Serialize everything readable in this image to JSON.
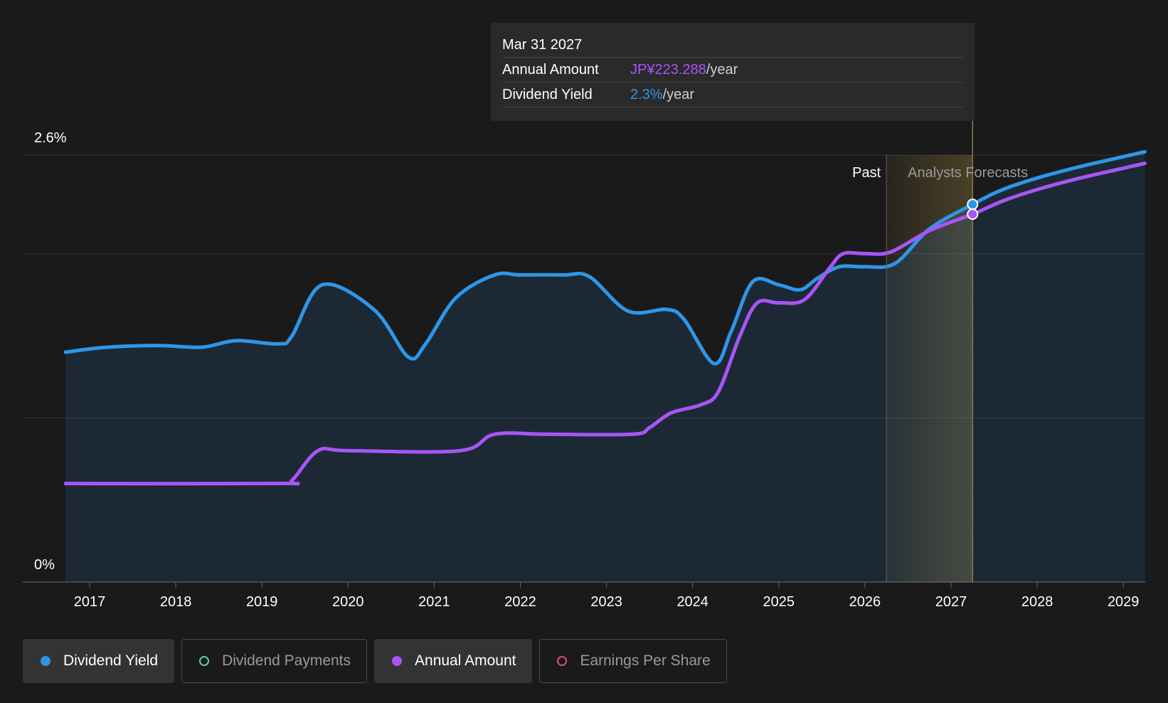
{
  "chart_data": {
    "type": "line",
    "ylim_label_top": "2.6%",
    "ylim_label_bottom": "0%",
    "x_ticks": [
      "2017",
      "2018",
      "2019",
      "2020",
      "2021",
      "2022",
      "2023",
      "2024",
      "2025",
      "2026",
      "2027",
      "2028",
      "2029"
    ],
    "period_labels": {
      "past": "Past",
      "forecast": "Analysts Forecasts"
    },
    "series": [
      {
        "name": "Dividend Yield",
        "color": "#2e96e8",
        "unit": "%",
        "points": [
          [
            2016.72,
            1.4
          ],
          [
            2017.2,
            1.43
          ],
          [
            2017.8,
            1.44
          ],
          [
            2018.3,
            1.43
          ],
          [
            2018.7,
            1.47
          ],
          [
            2019.2,
            1.45
          ],
          [
            2019.35,
            1.5
          ],
          [
            2019.7,
            1.81
          ],
          [
            2020.3,
            1.66
          ],
          [
            2020.7,
            1.37
          ],
          [
            2020.9,
            1.45
          ],
          [
            2021.25,
            1.73
          ],
          [
            2021.7,
            1.87
          ],
          [
            2022.0,
            1.87
          ],
          [
            2022.5,
            1.87
          ],
          [
            2022.8,
            1.86
          ],
          [
            2023.25,
            1.65
          ],
          [
            2023.7,
            1.66
          ],
          [
            2023.9,
            1.6
          ],
          [
            2024.25,
            1.33
          ],
          [
            2024.45,
            1.53
          ],
          [
            2024.7,
            1.83
          ],
          [
            2025.0,
            1.81
          ],
          [
            2025.25,
            1.78
          ],
          [
            2025.45,
            1.85
          ],
          [
            2025.7,
            1.92
          ],
          [
            2026.0,
            1.92
          ],
          [
            2026.35,
            1.94
          ],
          [
            2026.75,
            2.15
          ],
          [
            2027.25,
            2.3
          ],
          [
            2027.6,
            2.39
          ],
          [
            2028.0,
            2.46
          ],
          [
            2028.5,
            2.53
          ],
          [
            2029.0,
            2.59
          ],
          [
            2029.25,
            2.62
          ]
        ]
      },
      {
        "name": "Annual Amount",
        "color": "#a855f7",
        "unit": "JP¥",
        "points": [
          [
            2016.72,
            0.6
          ],
          [
            2019.2,
            0.6
          ],
          [
            2019.35,
            0.62
          ],
          [
            2019.65,
            0.8
          ],
          [
            2020.0,
            0.8
          ],
          [
            2021.3,
            0.8
          ],
          [
            2021.7,
            0.9
          ],
          [
            2022.3,
            0.9
          ],
          [
            2023.3,
            0.9
          ],
          [
            2023.5,
            0.94
          ],
          [
            2023.75,
            1.03
          ],
          [
            2024.1,
            1.08
          ],
          [
            2024.3,
            1.16
          ],
          [
            2024.55,
            1.5
          ],
          [
            2024.75,
            1.7
          ],
          [
            2025.0,
            1.7
          ],
          [
            2025.3,
            1.72
          ],
          [
            2025.6,
            1.92
          ],
          [
            2025.75,
            2.0
          ],
          [
            2026.0,
            2.0
          ],
          [
            2026.3,
            2.01
          ],
          [
            2026.75,
            2.14
          ],
          [
            2027.25,
            2.24
          ],
          [
            2027.6,
            2.32
          ],
          [
            2028.0,
            2.39
          ],
          [
            2028.5,
            2.46
          ],
          [
            2029.0,
            2.52
          ],
          [
            2029.25,
            2.55
          ]
        ]
      }
    ],
    "y_gridlines_percent": [
      0,
      1.0,
      2.0,
      2.6
    ],
    "past_end_year": 2026.25,
    "forecast_marker_year": 2027.25,
    "highlight": {
      "yield_at_marker": 2.3,
      "amount_at_marker": 2.24
    }
  },
  "tooltip": {
    "date": "Mar 31 2027",
    "amount_label": "Annual Amount",
    "amount_value": "JP¥223.288",
    "amount_unit": "/year",
    "yield_label": "Dividend Yield",
    "yield_value": "2.3%",
    "yield_unit": "/year"
  },
  "legend": [
    {
      "label": "Dividend Yield",
      "active": true,
      "color": "#2e96e8",
      "filled": true
    },
    {
      "label": "Dividend Payments",
      "active": false,
      "color": "#5ecfb8",
      "filled": false
    },
    {
      "label": "Annual Amount",
      "active": true,
      "color": "#a855f7",
      "filled": true
    },
    {
      "label": "Earnings Per Share",
      "active": false,
      "color": "#d94b8a",
      "filled": false
    }
  ]
}
